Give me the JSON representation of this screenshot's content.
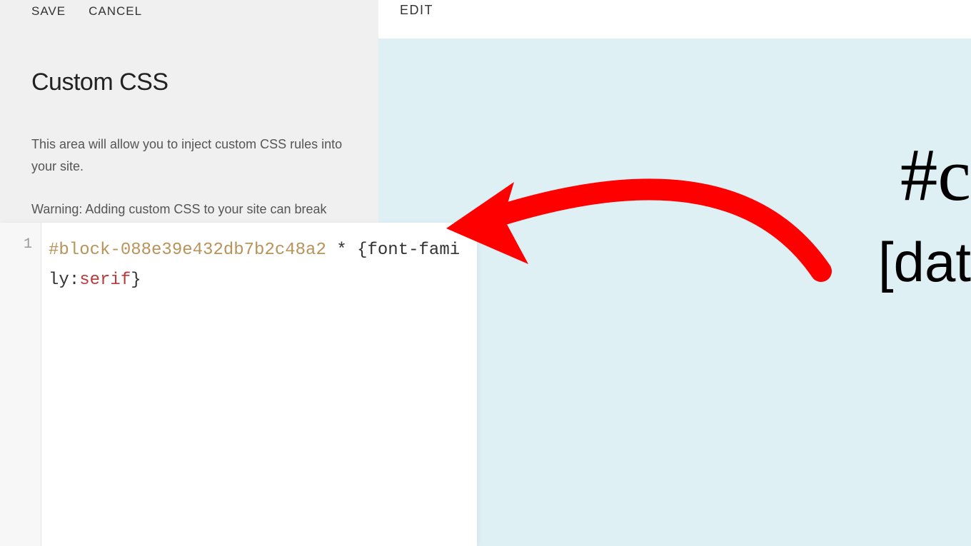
{
  "buttons": {
    "save": "SAVE",
    "cancel": "CANCEL"
  },
  "panel": {
    "title": "Custom CSS",
    "description": "This area will allow you to inject custom CSS rules into your site.",
    "warning": "Warning: Adding custom CSS to your site can break your design. Please use caution when using this feature. Our"
  },
  "editor": {
    "line_number": "1",
    "selector_id": "#block-088e39e432db7b2c48a2",
    "selector_star": " * ",
    "open_brace": "{",
    "property": "font-family",
    "colon": ":",
    "value": "serif",
    "close_brace": "}"
  },
  "preview": {
    "edit_label": "EDIT",
    "text1": "#c",
    "text2": "[dat"
  },
  "colors": {
    "arrow": "#ff0000"
  }
}
